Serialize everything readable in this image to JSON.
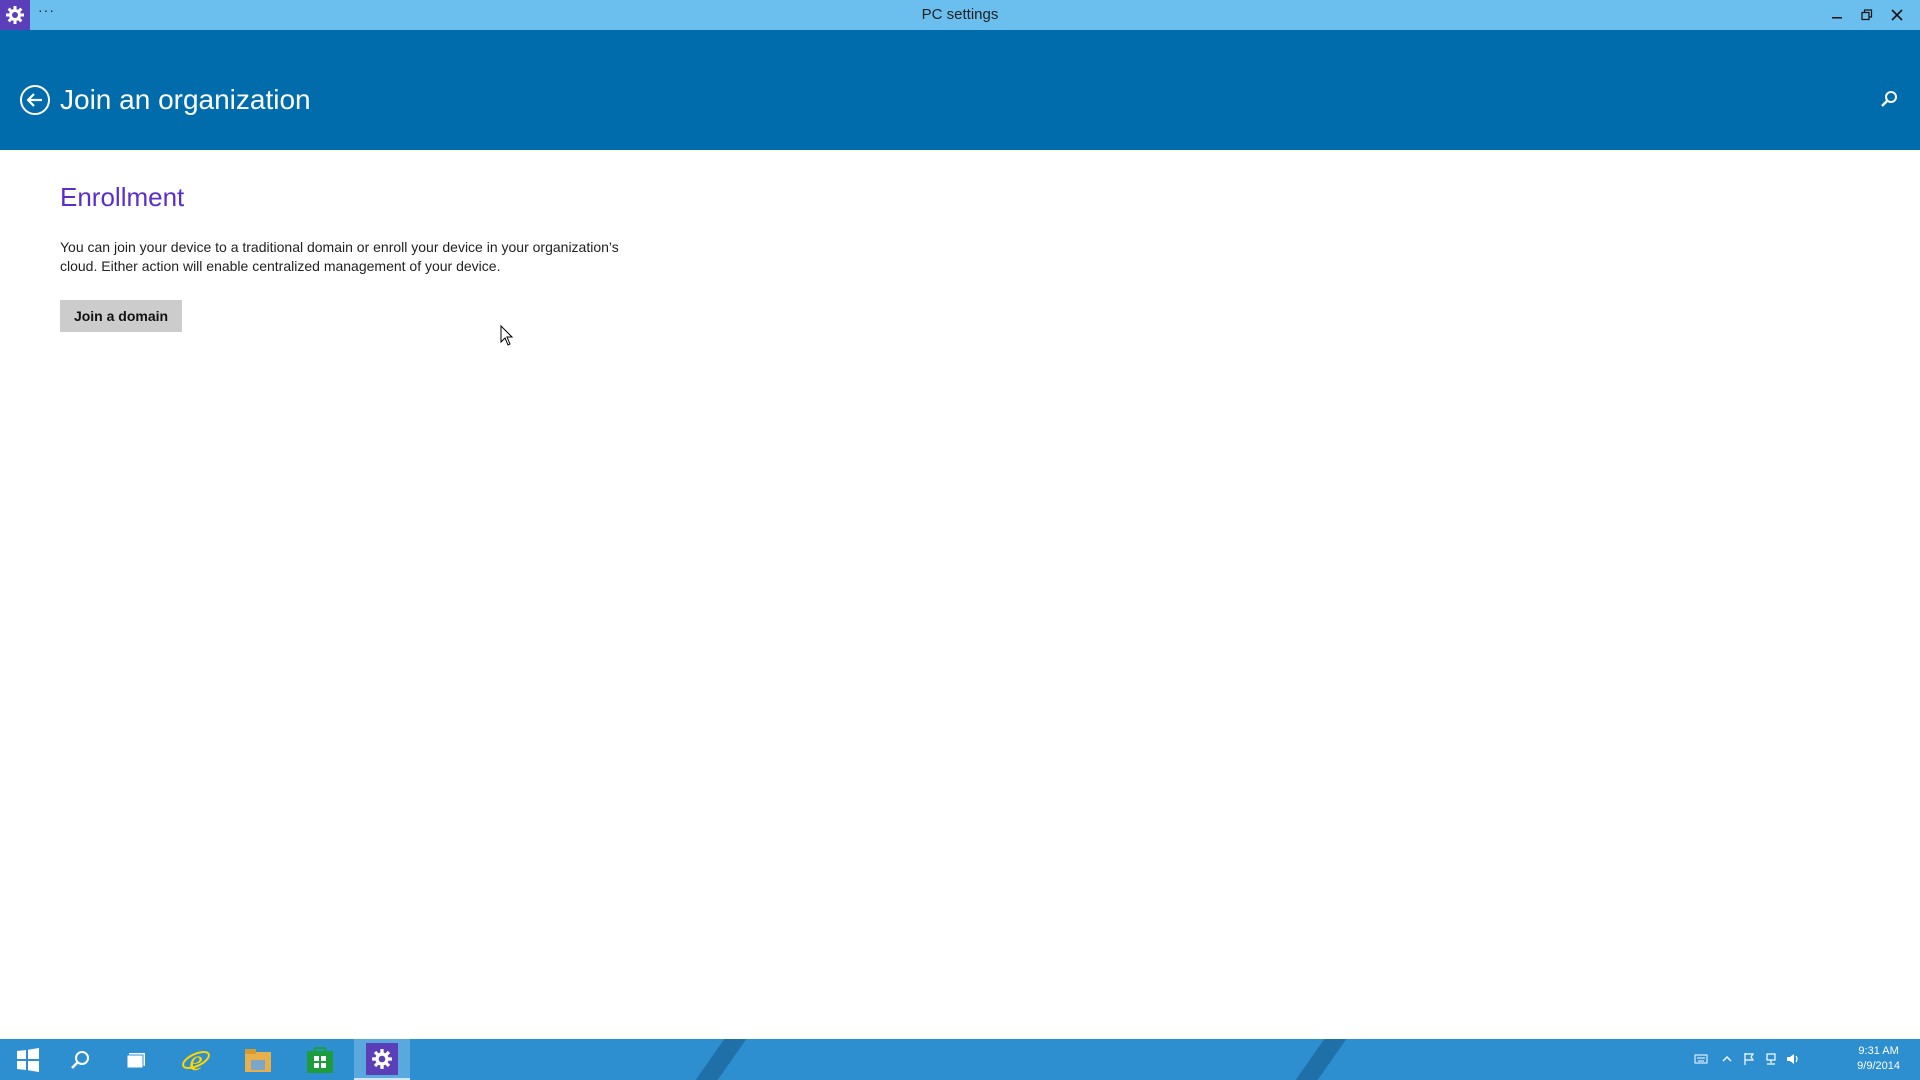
{
  "window": {
    "title": "PC settings",
    "more_label": "···",
    "app_icon": "gear-icon"
  },
  "header": {
    "title": "Join an organization",
    "back_icon": "back-arrow-icon",
    "search_icon": "search-icon"
  },
  "content": {
    "section_title": "Enrollment",
    "description": "You can join your device to a traditional domain or enroll your device in your organization’s cloud.  Either action will enable centralized management of your device.",
    "join_domain_label": "Join a domain"
  },
  "taskbar": {
    "items": [
      "start-icon",
      "search-icon",
      "task-view-icon",
      "internet-explorer-icon",
      "file-explorer-icon",
      "store-icon",
      "pc-settings-icon"
    ],
    "active_item": "pc-settings-icon",
    "clock_time": "9:31 AM",
    "clock_date": "9/9/2014"
  },
  "colors": {
    "titlebar": "#6bbfee",
    "header": "#006cab",
    "accent_title": "#5b2ec9",
    "app_icon_bg": "#5a3fb8",
    "taskbar": "#2d8fd0"
  }
}
